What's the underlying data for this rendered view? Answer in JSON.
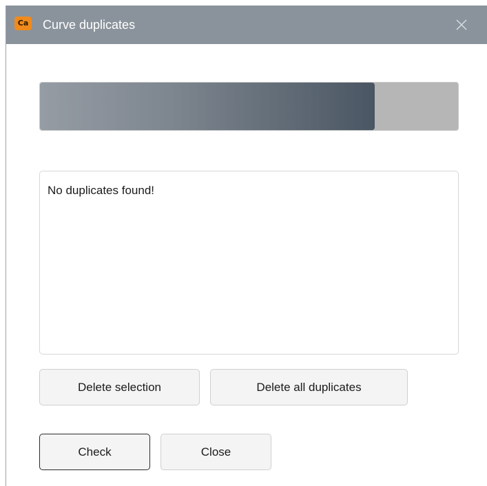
{
  "window": {
    "app_icon_text": "Ca",
    "title": "Curve duplicates",
    "close_icon": "close-icon"
  },
  "progress": {
    "value_fraction": 0.8,
    "fill_color": "#4a5663",
    "track_color": "#b6b6b6"
  },
  "output": {
    "text": "No duplicates found!"
  },
  "buttons": {
    "delete_selection": "Delete selection",
    "delete_all_duplicates": "Delete all duplicates",
    "check": "Check",
    "close": "Close"
  },
  "colors": {
    "titlebar": "#8a939c",
    "app_icon": "#f08a1c"
  }
}
